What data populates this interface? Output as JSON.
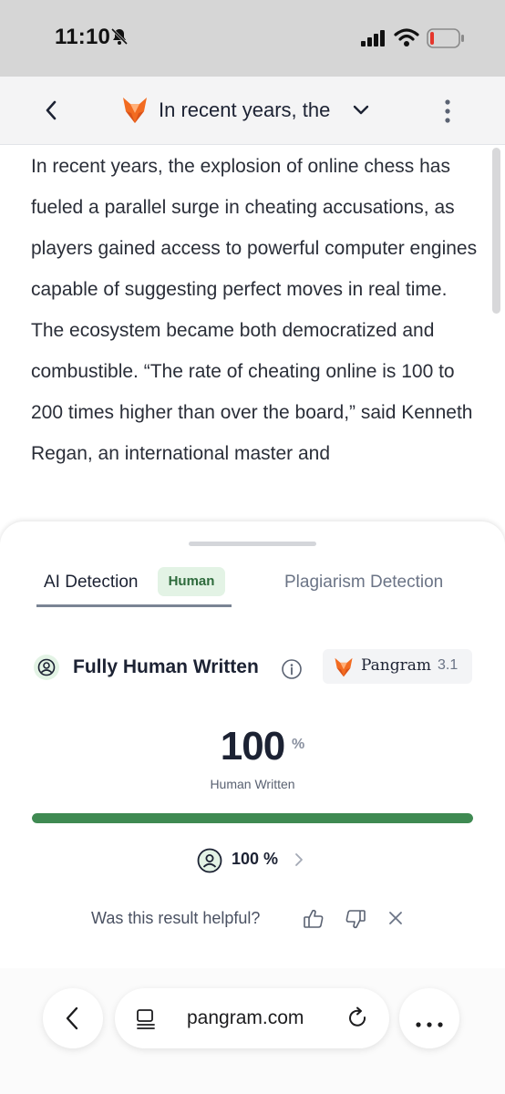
{
  "status_bar": {
    "time": "11:10"
  },
  "nav": {
    "title": "In recent years, the"
  },
  "article": {
    "text": "In recent years, the explosion of online chess has fueled a parallel surge in cheating accusations, as players gained access to powerful computer engines capable of suggesting perfect moves in real time. The ecosystem became both democratized and combustible. “The rate of cheating online is 100 to 200 times higher than over the board,” said Kenneth Regan, an international master and"
  },
  "sheet": {
    "tabs": [
      {
        "label": "AI Detection",
        "badge": "Human",
        "active": true
      },
      {
        "label": "Plagiarism Detection",
        "active": false
      }
    ],
    "verdict": "Fully Human Written",
    "model": {
      "name": "Pangram",
      "version": "3.1"
    },
    "score": {
      "value": "100",
      "unit": "%",
      "caption": "Human Written",
      "fraction": 1.0
    },
    "breakdown": {
      "text": "100 %"
    },
    "feedback": {
      "question": "Was this result helpful?"
    }
  },
  "browser": {
    "url": "pangram.com"
  },
  "colors": {
    "accent_green": "#3f8a52",
    "badge_bg": "#e3f3e5",
    "fox_orange": "#f26b21"
  },
  "icons": [
    "bell-slash-icon",
    "signal-icon",
    "wifi-icon",
    "battery-icon",
    "back-icon",
    "fox-logo-icon",
    "chevron-down-icon",
    "more-vertical-icon",
    "user-circle-icon",
    "info-icon",
    "thumbs-up-icon",
    "thumbs-down-icon",
    "close-icon",
    "reader-icon",
    "reload-icon",
    "more-horizontal-icon"
  ]
}
